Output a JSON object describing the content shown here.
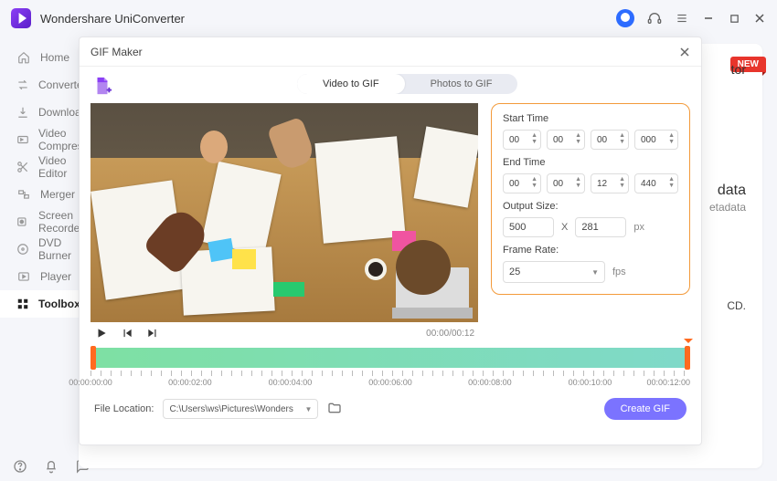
{
  "app": {
    "title": "Wondershare UniConverter"
  },
  "titlebar": {},
  "sidebar": {
    "items": [
      {
        "label": "Home"
      },
      {
        "label": "Converter"
      },
      {
        "label": "Downloader"
      },
      {
        "label": "Video Compressor"
      },
      {
        "label": "Video Editor"
      },
      {
        "label": "Merger"
      },
      {
        "label": "Screen Recorder"
      },
      {
        "label": "DVD Burner"
      },
      {
        "label": "Player"
      },
      {
        "label": "Toolbox"
      }
    ]
  },
  "bg": {
    "new": "NEW",
    "w1": "tor",
    "w2": "data",
    "w3": "etadata",
    "w4": "CD."
  },
  "modal": {
    "title": "GIF Maker",
    "tabs": {
      "video": "Video to GIF",
      "photos": "Photos to GIF"
    },
    "time_display": "00:00/00:12",
    "settings": {
      "start_label": "Start Time",
      "end_label": "End Time",
      "output_label": "Output Size:",
      "frame_label": "Frame Rate:",
      "start": {
        "h": "00",
        "m": "00",
        "s": "00",
        "ms": "000"
      },
      "end": {
        "h": "00",
        "m": "00",
        "s": "12",
        "ms": "440"
      },
      "width": "500",
      "height": "281",
      "px": "px",
      "x": "X",
      "fps_value": "25",
      "fps_unit": "fps"
    },
    "ruler": [
      "00:00:00:00",
      "00:00:02:00",
      "00:00:04:00",
      "00:00:06:00",
      "00:00:08:00",
      "00:00:10:00",
      "00:00:12:00"
    ],
    "file_label": "File Location:",
    "file_path": "C:\\Users\\ws\\Pictures\\Wonders",
    "create": "Create GIF"
  }
}
